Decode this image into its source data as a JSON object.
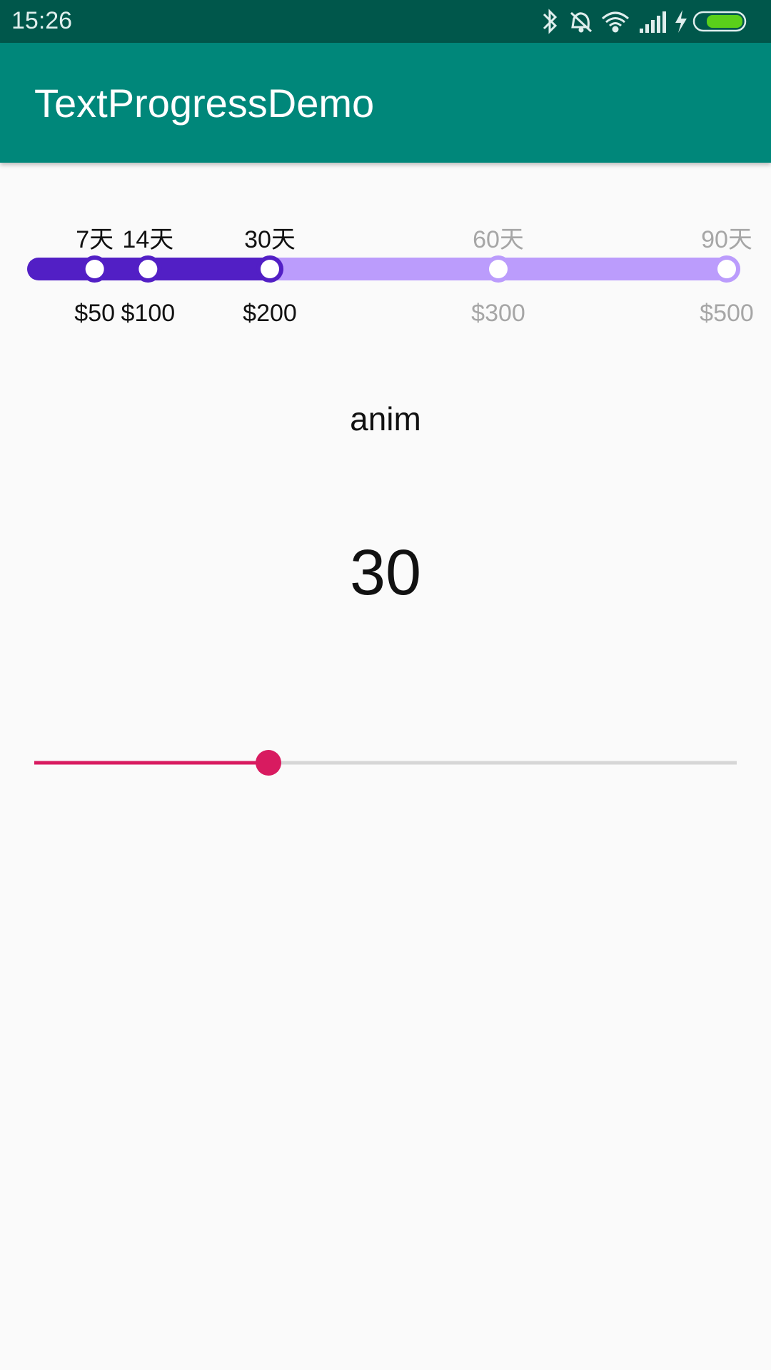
{
  "status_bar": {
    "time": "15:26",
    "icons": [
      "bluetooth-icon",
      "silent-alarm-icon",
      "wifi-icon",
      "signal-icon",
      "charging-icon",
      "battery-icon"
    ]
  },
  "app_bar": {
    "title": "TextProgressDemo"
  },
  "text_progress": {
    "progress": 30,
    "max": 90,
    "colors": {
      "done_track": "#521fc5",
      "todo_track": "#bb9cfc",
      "done_text": "#111111",
      "todo_text": "#a6a6a6"
    },
    "nodes": [
      {
        "days": 7,
        "top_label": "7天",
        "bottom_label": "$50",
        "reached": true
      },
      {
        "days": 14,
        "top_label": "14天",
        "bottom_label": "$100",
        "reached": true
      },
      {
        "days": 30,
        "top_label": "30天",
        "bottom_label": "$200",
        "reached": true
      },
      {
        "days": 60,
        "top_label": "60天",
        "bottom_label": "$300",
        "reached": false
      },
      {
        "days": 90,
        "top_label": "90天",
        "bottom_label": "$500",
        "reached": false
      }
    ]
  },
  "anim_label": "anim",
  "value_display": "30",
  "seekbar": {
    "value": 30,
    "max": 90,
    "accent": "#d81b60",
    "track": "#d6d6d6"
  }
}
